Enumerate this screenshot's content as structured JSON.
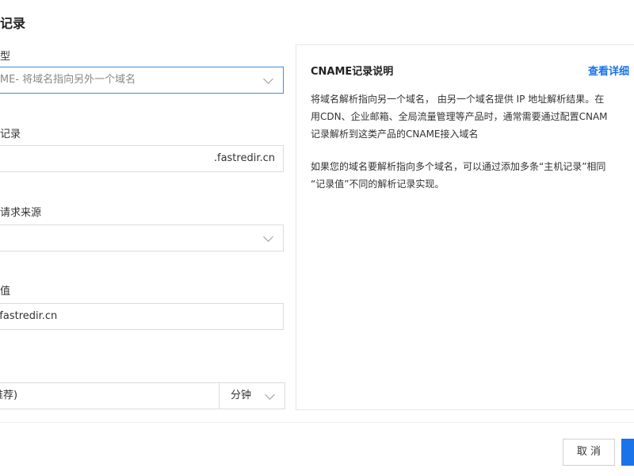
{
  "dialog": {
    "title": "记录"
  },
  "form": {
    "record_type": {
      "label": "型",
      "value": "AME- 将域名指向另外一个域名"
    },
    "host_record": {
      "label": "记录",
      "suffix": ".fastredir.cn"
    },
    "request_source": {
      "label": "请求来源",
      "value": ""
    },
    "record_value": {
      "label": "值",
      "value": "r.fastredir.cn"
    },
    "ttl": {
      "value": "推荐)",
      "unit": "分钟"
    }
  },
  "info_panel": {
    "title": "CNAME记录说明",
    "link": "查看详细",
    "paragraph1": [
      "将域名解析指向另一个域名， 由另一个域名提供 IP 地址解析结果。在",
      "用CDN、企业邮箱、全局流量管理等产品时，通常需要通过配置CNAM",
      "记录解析到这类产品的CNAME接入域名"
    ],
    "paragraph2": [
      "如果您的域名要解析指向多个域名，可以通过添加多条“主机记录”相同",
      "“记录值”不同的解析记录实现。"
    ]
  },
  "footer": {
    "cancel_label": "取 消"
  },
  "colors": {
    "primary": "#1a73e8",
    "focus_border": "#3a8ee6",
    "border": "#dcdcdc"
  }
}
